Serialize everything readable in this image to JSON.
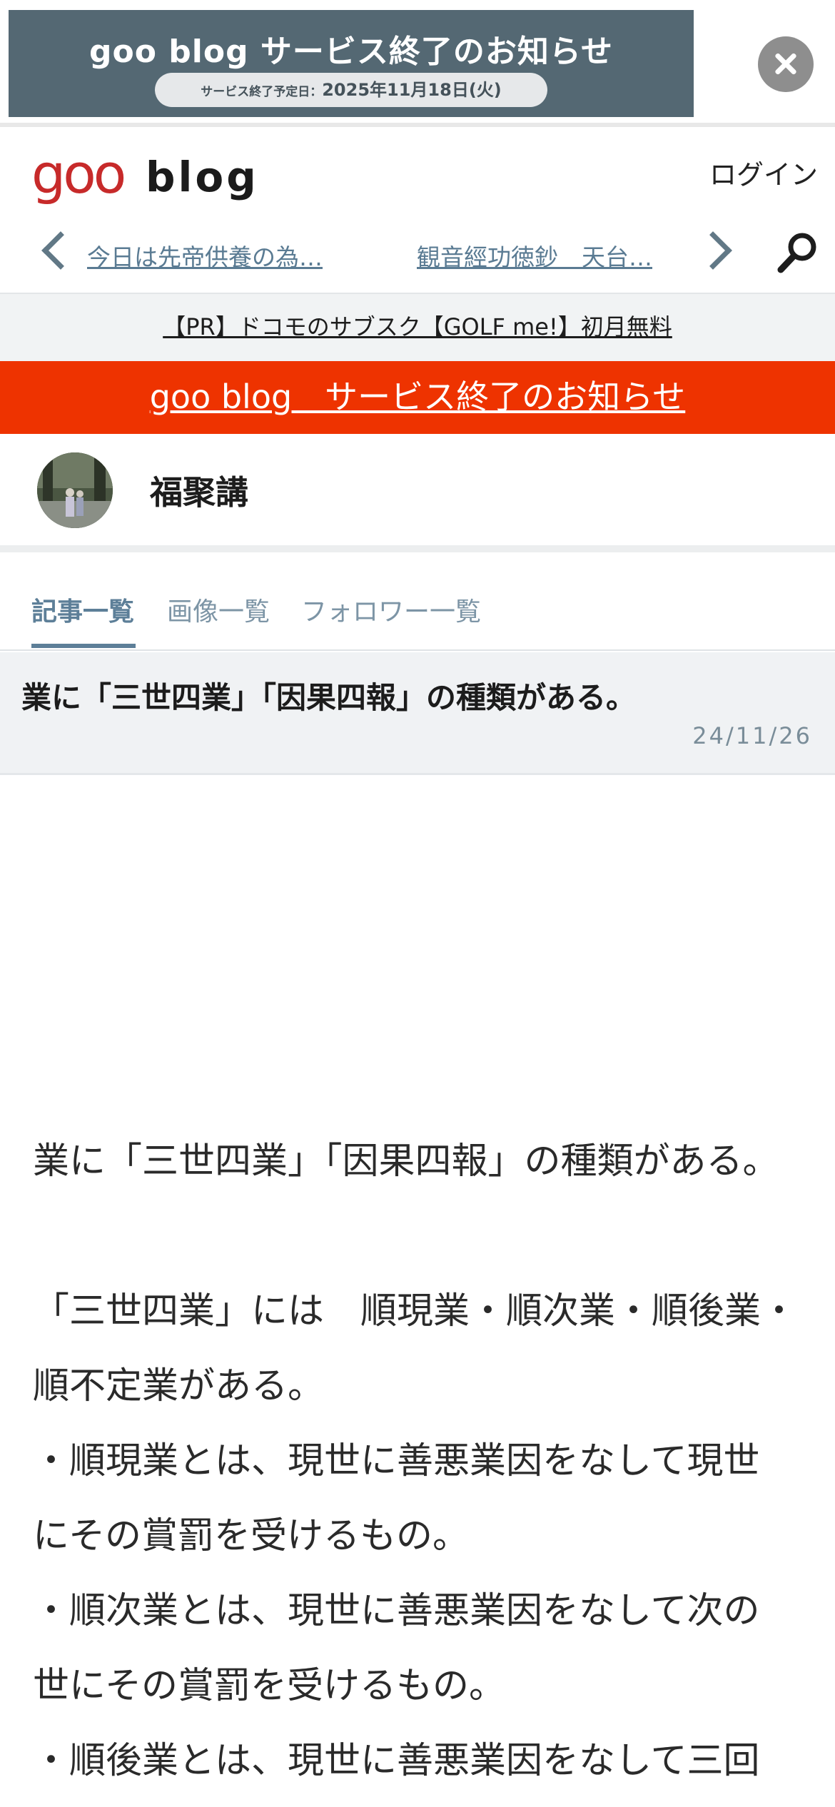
{
  "ad": {
    "title": "goo blog サービス終了のお知らせ",
    "pill_label": "サービス終了予定日：",
    "pill_date": "2025年11月18日(火)"
  },
  "header": {
    "logo_goo": "goo",
    "logo_blog": "blog",
    "login": "ログイン"
  },
  "nav": {
    "prev_title": "今日は先帝供養の為…",
    "next_title": "観音經功徳鈔　天台…"
  },
  "pr": {
    "text": "【PR】ドコモのサブスク【GOLF me!】初月無料"
  },
  "notice": {
    "text": "goo blog　サービス終了のお知らせ"
  },
  "profile": {
    "blog_name": "福聚講"
  },
  "tabs": [
    {
      "label": "記事一覧",
      "active": true
    },
    {
      "label": "画像一覧",
      "active": false
    },
    {
      "label": "フォロワー一覧",
      "active": false
    }
  ],
  "article": {
    "title": "業に「三世四業」「因果四報」の種類がある。",
    "date": "24/11/26",
    "lines": [
      "業に「三世四業」「因果四報」の種類がある。",
      "「三世四業」には　順現業・順次業・順後業・",
      "順不定業がある。",
      "・順現業とは、現世に善悪業因をなして現世",
      "にその賞罰を受けるもの。",
      "・順次業とは、現世に善悪業因をなして次の",
      "世にその賞罰を受けるもの。",
      "・順後業とは、現世に善悪業因をなして三回"
    ]
  },
  "colors": {
    "ad_banner": "#546873",
    "notice_bar": "#ee3300",
    "logo_red": "#c72a2a",
    "link_blue": "#5a7b93",
    "tab_active": "#5d7f98"
  }
}
